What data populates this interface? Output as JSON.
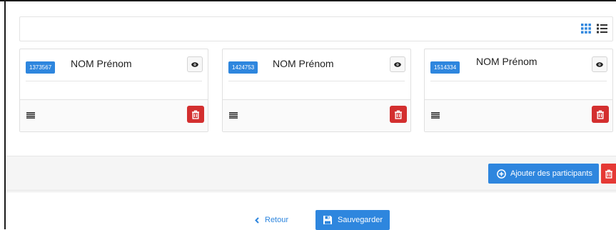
{
  "toolbar": {
    "grid_view_icon": "grid-icon",
    "list_view_icon": "list-icon"
  },
  "participants": [
    {
      "id": "1373567",
      "name": "NOM Prénom"
    },
    {
      "id": "1424753",
      "name": "NOM Prénom"
    },
    {
      "id": "1514334",
      "name": "NOM Prénom"
    }
  ],
  "actions": {
    "add_participants_label": "Ajouter des participants"
  },
  "footer": {
    "back_label": "Retour",
    "save_label": "Sauvegarder"
  },
  "colors": {
    "primary": "#2e86de",
    "danger": "#d32f2f"
  }
}
